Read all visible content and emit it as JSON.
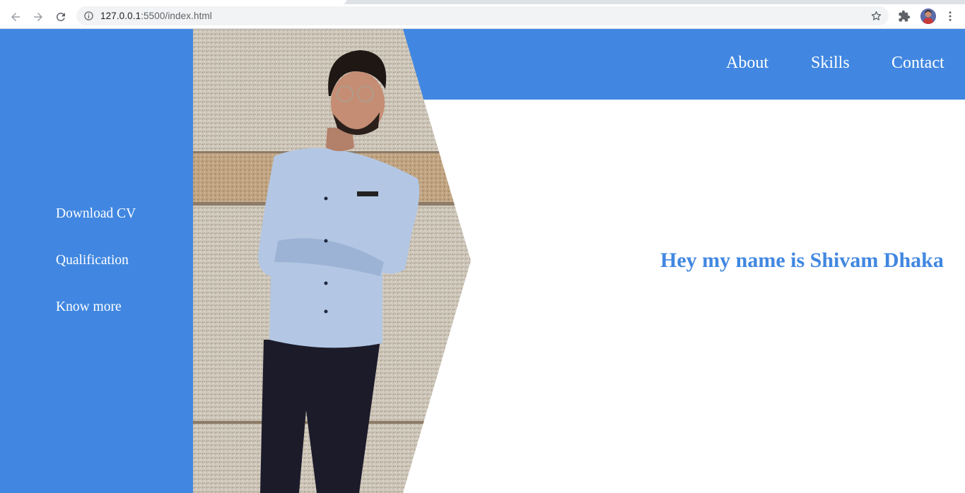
{
  "browser": {
    "url_host": "127.0.0.1",
    "url_rest": ":5500/index.html",
    "icons": {
      "back": "arrow-left-icon",
      "forward": "arrow-right-icon",
      "reload": "reload-icon",
      "info": "info-icon",
      "bookmark": "star-icon",
      "extensions": "puzzle-icon",
      "profile": "avatar",
      "menu": "kebab-menu-icon"
    }
  },
  "colors": {
    "accent": "#4187e1",
    "text_on_accent": "#ffffff",
    "background": "#ffffff"
  },
  "header": {
    "nav": [
      "About",
      "Skills",
      "Contact"
    ]
  },
  "sidebar": {
    "links": [
      "Download CV",
      "Qualification",
      "Know more"
    ]
  },
  "main": {
    "hero_heading": "Hey my name is Shivam Dhaka"
  }
}
